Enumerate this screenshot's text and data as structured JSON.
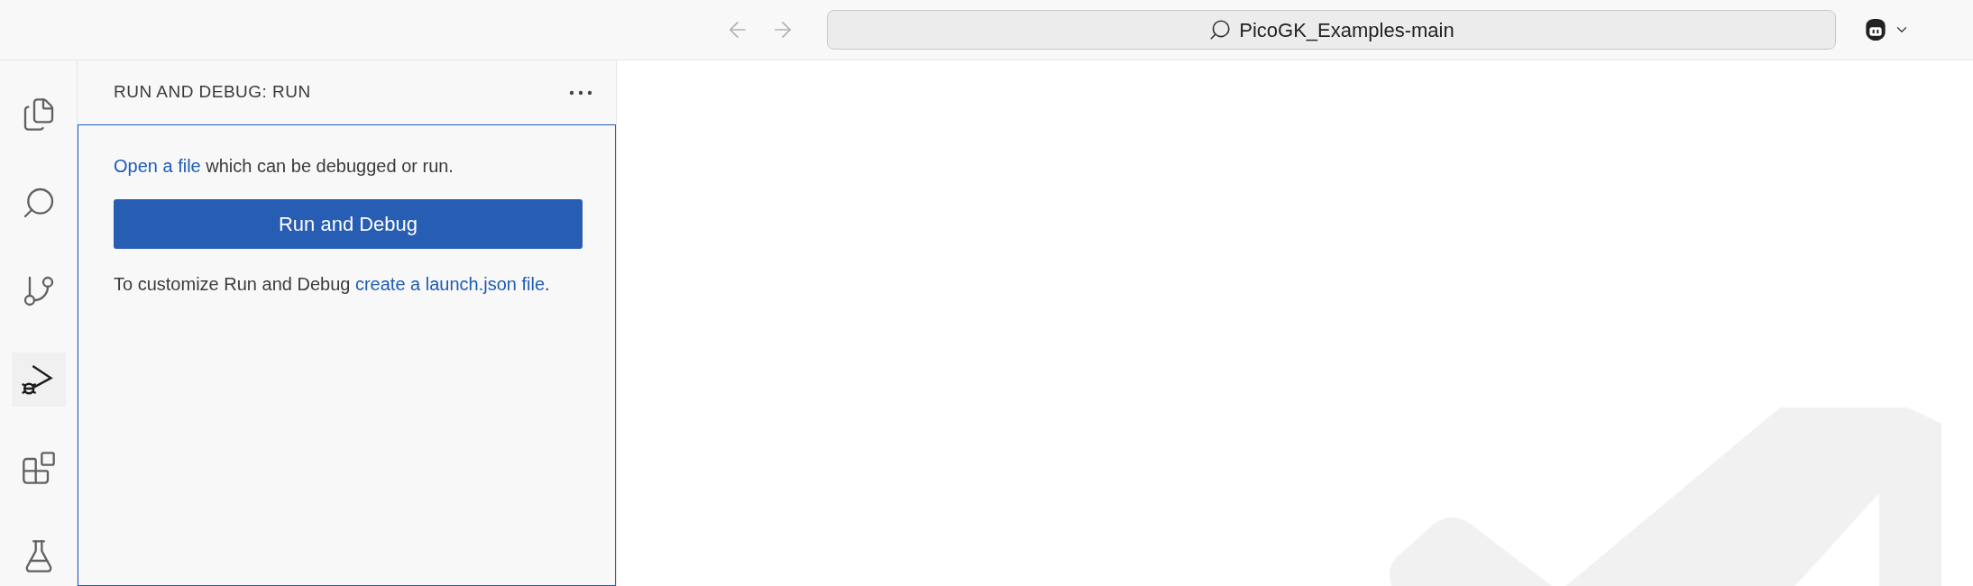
{
  "title_bar": {
    "search": {
      "value": "PicoGK_Examples-main"
    }
  },
  "activity_bar": {
    "items": [
      {
        "kind": "files",
        "selected": false
      },
      {
        "kind": "search",
        "selected": false
      },
      {
        "kind": "source-control",
        "selected": false
      },
      {
        "kind": "run-debug",
        "selected": true
      },
      {
        "kind": "extensions",
        "selected": false
      },
      {
        "kind": "testing",
        "selected": false
      }
    ]
  },
  "sidebar": {
    "title": "RUN AND DEBUG: RUN",
    "intro": [
      {
        "kind": "link",
        "text": "Open a file"
      },
      {
        "kind": "text",
        "text": " which can be debugged or run."
      }
    ],
    "run_button": "Run and Debug",
    "customize": [
      {
        "kind": "text",
        "text": "To customize Run and Debug "
      },
      {
        "kind": "link",
        "text": "create a launch.json file"
      },
      {
        "kind": "text",
        "text": "."
      }
    ]
  }
}
